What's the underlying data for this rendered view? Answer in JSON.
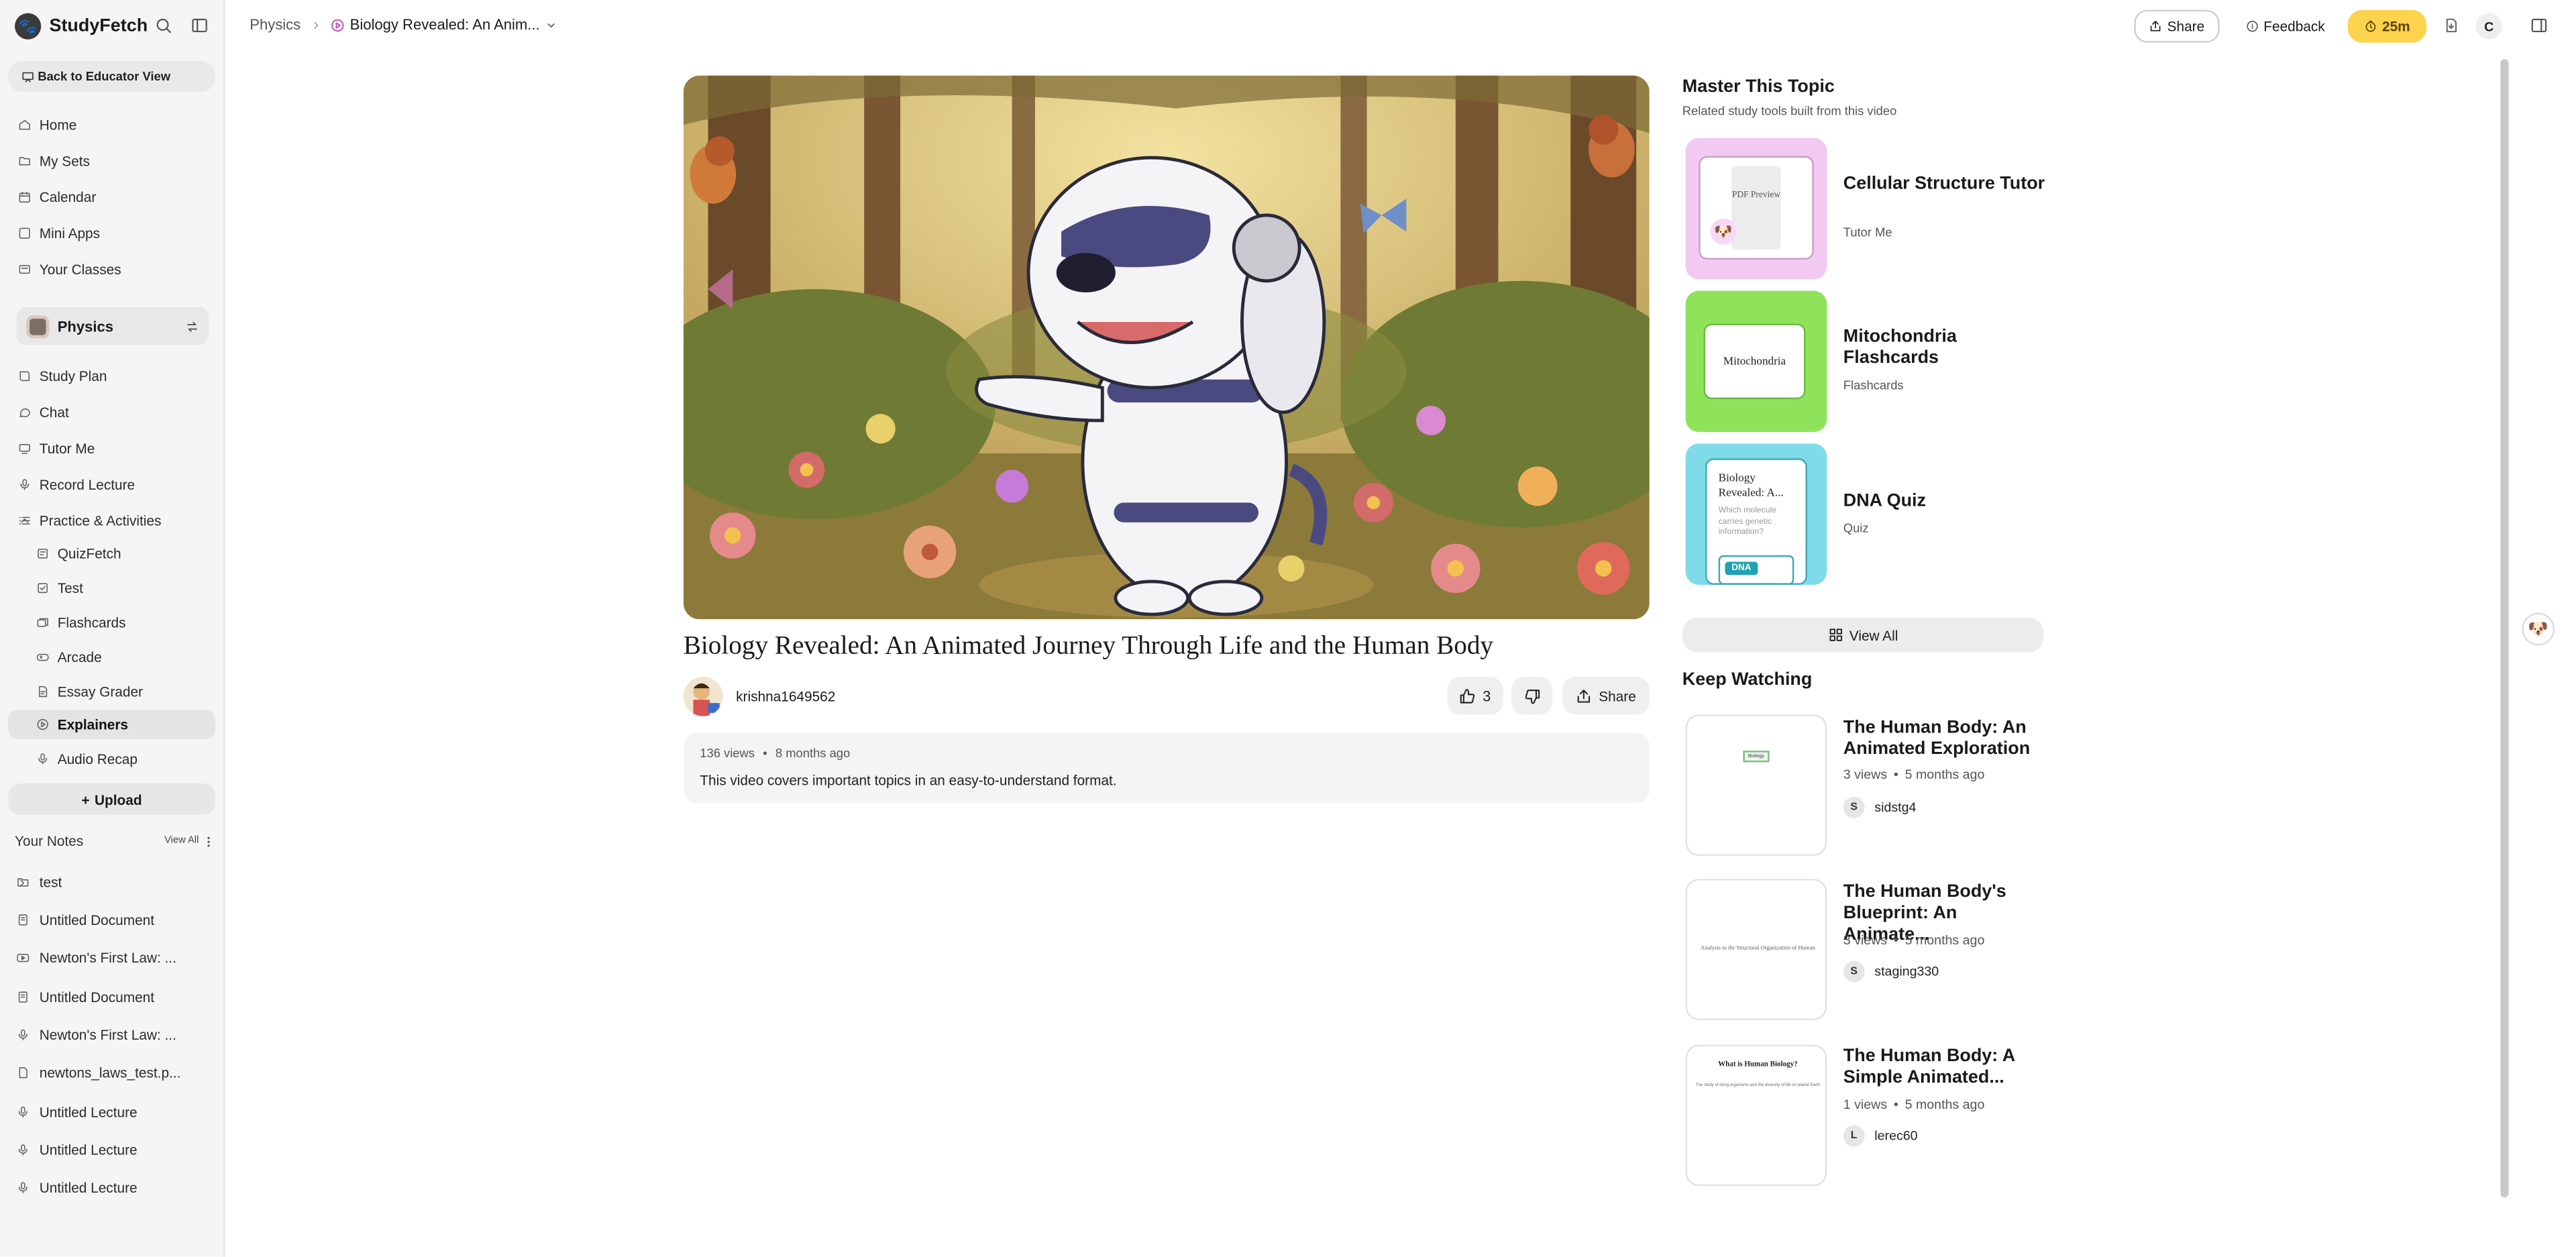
{
  "app": {
    "name": "StudyFetch"
  },
  "sidebar": {
    "back_button": "Back to Educator View",
    "nav": [
      {
        "label": "Home"
      },
      {
        "label": "My Sets"
      },
      {
        "label": "Calendar"
      },
      {
        "label": "Mini Apps"
      },
      {
        "label": "Your Classes"
      }
    ],
    "class_selector": "Physics",
    "class_nav": [
      {
        "label": "Study Plan"
      },
      {
        "label": "Chat"
      },
      {
        "label": "Tutor Me"
      },
      {
        "label": "Record Lecture"
      },
      {
        "label": "Practice & Activities"
      }
    ],
    "practice_items": [
      {
        "label": "QuizFetch"
      },
      {
        "label": "Test"
      },
      {
        "label": "Flashcards"
      },
      {
        "label": "Arcade"
      },
      {
        "label": "Essay Grader"
      },
      {
        "label": "Explainers"
      },
      {
        "label": "Audio Recap"
      }
    ],
    "upload_label": "Upload",
    "notes": {
      "title": "Your Notes",
      "view_all": "View All",
      "items": [
        {
          "label": "test"
        },
        {
          "label": "Untitled Document"
        },
        {
          "label": "Newton's First Law: ..."
        },
        {
          "label": "Untitled Document"
        },
        {
          "label": "Newton's First Law: ..."
        },
        {
          "label": "newtons_laws_test.p..."
        },
        {
          "label": "Untitled Lecture"
        },
        {
          "label": "Untitled Lecture"
        },
        {
          "label": "Untitled Lecture"
        }
      ]
    }
  },
  "topbar": {
    "breadcrumb_root": "Physics",
    "breadcrumb_current": "Biology Revealed: An Anim...",
    "share": "Share",
    "feedback": "Feedback",
    "timer": "25m",
    "avatar_initial": "C"
  },
  "video": {
    "title": "Biology Revealed: An Animated Journey Through Life and the Human Body",
    "uploader": "krishna1649562",
    "likes": "3",
    "share": "Share",
    "views": "136 views",
    "age": "8 months ago",
    "description": "This video covers important topics in an easy-to-understand format."
  },
  "master_topic": {
    "title": "Master This Topic",
    "subtitle": "Related study tools built from this video",
    "tools": [
      {
        "title": "Cellular Structure Tutor",
        "type": "Tutor Me",
        "thumb_text": "PDF Preview"
      },
      {
        "title": "Mitochondria Flashcards",
        "type": "Flashcards",
        "thumb_text": "Mitochondria"
      },
      {
        "title": "DNA Quiz",
        "type": "Quiz",
        "thumb_title": "Biology Revealed: A...",
        "thumb_question": "Which molecule carries genetic information?",
        "thumb_answer": "DNA"
      }
    ],
    "view_all": "View All"
  },
  "keep_watching": {
    "title": "Keep Watching",
    "items": [
      {
        "title": "The Human Body: An Animated Exploration",
        "views": "3 views",
        "age": "5 months ago",
        "user": "sidstg4",
        "initial": "S",
        "thumb_text": "Biology"
      },
      {
        "title": "The Human Body's Blueprint: An Animate...",
        "views": "3 views",
        "age": "5 months ago",
        "user": "staging330",
        "initial": "S",
        "thumb_text": "Analysis to the Structural Organization of Human"
      },
      {
        "title": "The Human Body: A Simple Animated...",
        "views": "1 views",
        "age": "5 months ago",
        "user": "lerec60",
        "initial": "L",
        "thumb_text": "What is Human Biology?",
        "thumb_sub": "The study of living organisms and the diversity of life on planet Earth"
      }
    ]
  },
  "colors": {
    "timer_bg": "#fcd34d",
    "tutor_thumb": "#f1c9f1",
    "flashcards_thumb": "#8fe35a",
    "quiz_thumb": "#7fdbe8",
    "accent": "#c24bb5"
  }
}
